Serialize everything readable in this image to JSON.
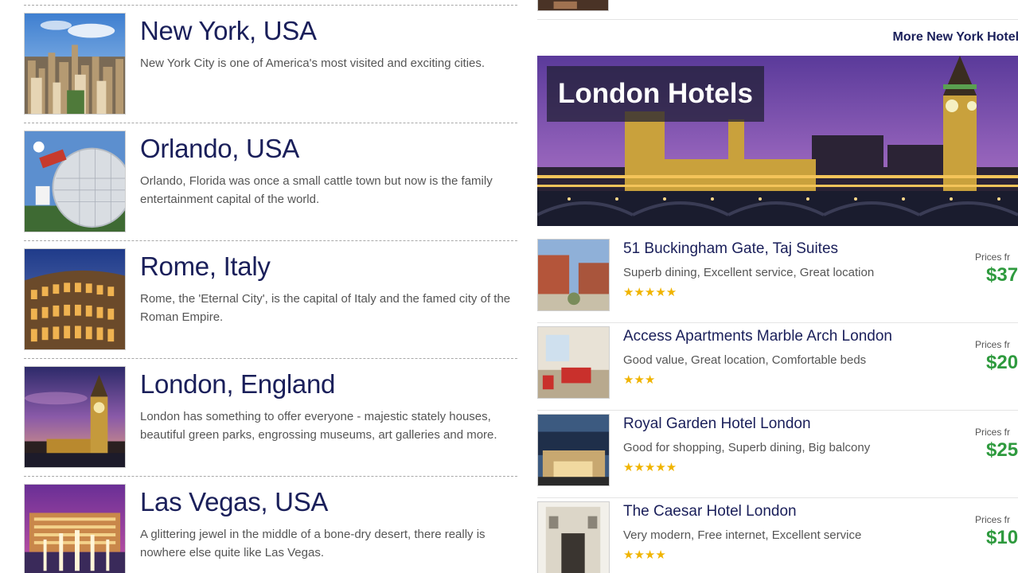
{
  "destinations": [
    {
      "title": "New York, USA",
      "description": "New York City is one of America's most visited and exciting cities.",
      "image": "new-york-skyline-image"
    },
    {
      "title": "Orlando, USA",
      "description": "Orlando, Florida was once a small cattle town but now is the family entertainment capital of the world.",
      "image": "epcot-sphere-image"
    },
    {
      "title": "Rome, Italy",
      "description": "Rome, the 'Eternal City', is the capital of Italy and the famed city of the Roman Empire.",
      "image": "colosseum-image"
    },
    {
      "title": "London, England",
      "description": "London has something to offer everyone - majestic stately houses, beautiful green parks, engrossing museums, art galleries and more.",
      "image": "big-ben-image"
    },
    {
      "title": "Las Vegas, USA",
      "description": "A glittering jewel in the middle of a bone-dry desert, there really is nowhere else quite like Las Vegas.",
      "image": "bellagio-fountains-image"
    }
  ],
  "more_link": "More New York Hotels",
  "banner": {
    "title": "London Hotels"
  },
  "hotels": [
    {
      "name": "51 Buckingham Gate, Taj Suites",
      "features": "Superb dining, Excellent service, Great location",
      "stars": "★★★★★",
      "price_label": "Prices fr",
      "price": "$37"
    },
    {
      "name": "Access Apartments Marble Arch London",
      "features": "Good value, Great location, Comfortable beds",
      "stars": "★★★",
      "price_label": "Prices fr",
      "price": "$20"
    },
    {
      "name": "Royal Garden Hotel London",
      "features": "Good for shopping, Superb dining, Big balcony",
      "stars": "★★★★★",
      "price_label": "Prices fr",
      "price": "$25"
    },
    {
      "name": "The Caesar Hotel London",
      "features": "Very modern, Free internet, Excellent service",
      "stars": "★★★★",
      "price_label": "Prices fr",
      "price": "$10"
    }
  ],
  "colors": {
    "title": "#1a1f5a",
    "price": "#2e9a3e",
    "stars": "#f0b400"
  }
}
